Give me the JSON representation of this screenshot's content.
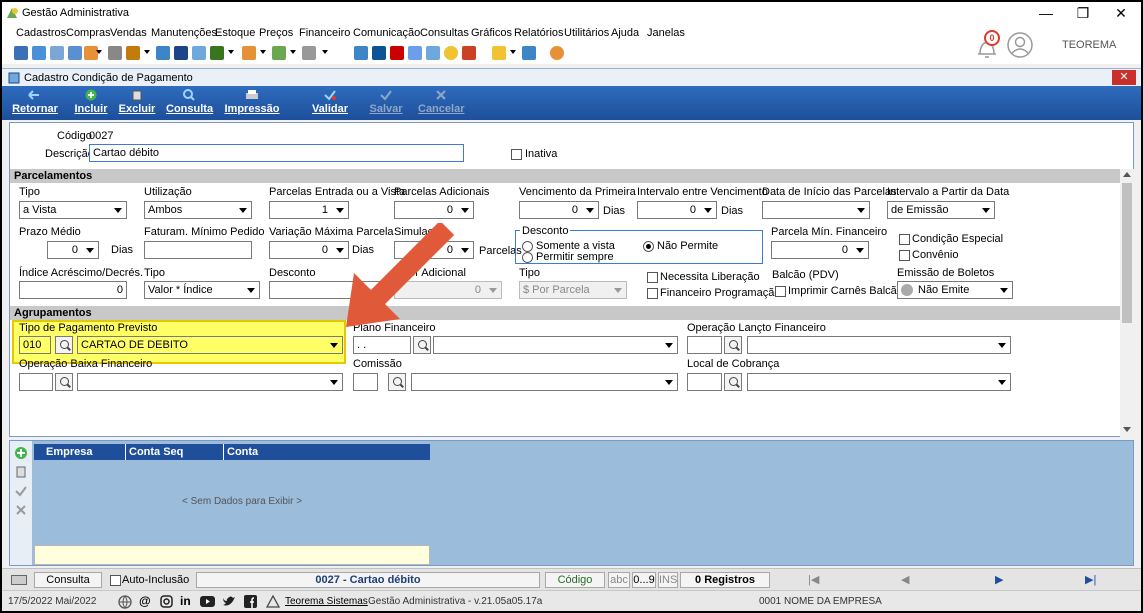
{
  "window": {
    "title": "Gestão Administrativa",
    "minimize": "—",
    "restore": "❐",
    "close": "✕"
  },
  "menu": [
    "Cadastros",
    "Compras",
    "Vendas",
    "Manutenções",
    "Estoque",
    "Preços",
    "Financeiro",
    "Comunicação",
    "Consultas",
    "Gráficos",
    "Relatórios",
    "Utilitários",
    "Ajuda",
    "Janelas"
  ],
  "header": {
    "notification_count": "0",
    "company_label": "TEOREMA"
  },
  "form": {
    "title": "Cadastro Condição de Pagamento",
    "toolbar": [
      "Retornar",
      "Incluir",
      "Excluir",
      "Consulta",
      "Impressão",
      "Validar",
      "Salvar",
      "Cancelar"
    ],
    "codigo_label": "Código",
    "codigo_value": "0027",
    "descricao_label": "Descrição",
    "descricao_value": "Cartao débito",
    "inativa_label": "Inativa"
  },
  "parcelamentos": {
    "section_title": "Parcelamentos",
    "tipo_label": "Tipo",
    "tipo_value": "a Vista",
    "utilizacao_label": "Utilização",
    "utilizacao_value": "Ambos",
    "parcelas_entrada_label": "Parcelas Entrada ou a Vista",
    "parcelas_entrada_value": "1",
    "parcelas_adicionais_label": "Parcelas Adicionais",
    "parcelas_adicionais_value": "0",
    "vencimento_primeira_label": "Vencimento da Primeira",
    "vencimento_primeira_value": "0",
    "dias_label": "Dias",
    "intervalo_vencimento_label": "Intervalo entre Vencimento",
    "intervalo_vencimento_value": "0",
    "data_inicio_label": "Data de Início das Parcelas",
    "data_inicio_value": "",
    "intervalo_partir_label": "Intervalo a Partir da Data",
    "intervalo_partir_value": "de Emissão",
    "prazo_medio_label": "Prazo Médio",
    "prazo_medio_value": "0",
    "faturam_minimo_label": "Faturam. Mínimo Pedido",
    "faturam_minimo_value": "",
    "variacao_maxima_label": "Variação Máxima Parcela",
    "variacao_maxima_value": "0",
    "simulacao_label": "Simulação",
    "simulacao_value": "0",
    "parcelas_label": "Parcelas",
    "desconto_group_label": "Desconto",
    "desconto_opt1": "Somente a vista",
    "desconto_opt2": "Permitir sempre",
    "desconto_opt3": "Não Permite",
    "parcela_min_label": "Parcela Mín. Financeiro",
    "parcela_min_value": "0",
    "condicao_especial_label": "Condição Especial",
    "convenio_label": "Convênio",
    "indice_label": "Índice Acréscimo/Decrés.",
    "indice_value": "0",
    "tipo2_label": "Tipo",
    "tipo2_value": "Valor * Índice",
    "desconto_label": "Desconto",
    "desconto_value": "",
    "valor_adicional_label": "Valor Adicional",
    "valor_adicional_value": "0",
    "tipo3_label": "Tipo",
    "tipo3_value": "$ Por Parcela",
    "necessita_liberacao_label": "Necessita Liberação",
    "financeiro_programacao_label": "Financeiro Programação",
    "balcao_label": "Balcão (PDV)",
    "imprimir_carnes_label": "Imprimir Carnês Balcão",
    "emissao_boletos_label": "Emissão de Boletos",
    "emissao_boletos_value": "Não Emite"
  },
  "agrupamentos": {
    "section_title": "Agrupamentos",
    "tipo_pagamento_label": "Tipo de Pagamento Previsto",
    "tipo_pagamento_code": "010",
    "tipo_pagamento_value": "CARTAO DE DEBITO",
    "plano_financeiro_label": "Plano Financeiro",
    "plano_financeiro_code": " .  .",
    "operacao_lancto_label": "Operação Lançto Financeiro",
    "operacao_baixa_label": "Operação Baixa Financeiro",
    "comissao_label": "Comissão",
    "local_cobranca_label": "Local de Cobrança"
  },
  "grid": {
    "columns": [
      "Empresa",
      "Conta Seq",
      "Conta"
    ],
    "empty_text": "< Sem Dados para Exibir >"
  },
  "statusbar": {
    "consulta": "Consulta",
    "auto_inclusao": "Auto-Inclusão",
    "record": "0027 - Cartao débito",
    "codigo": "Código",
    "abc": "abc",
    "nums": "0...9",
    "ins": "INS",
    "registros": "0 Registros"
  },
  "footer": {
    "date": "17/5/2022 Mai/2022",
    "teorema_link": "Teorema Sistemas",
    "version": "Gestão Administrativa - v.21.05a05.17a",
    "empresa": "0001 NOME DA EMPRESA"
  },
  "colors": {
    "highlight": "#ffff66",
    "arrow": "#e05a3a",
    "toolbar_blue": "#2f6cbe",
    "grid_blue": "#9cbcdc"
  }
}
